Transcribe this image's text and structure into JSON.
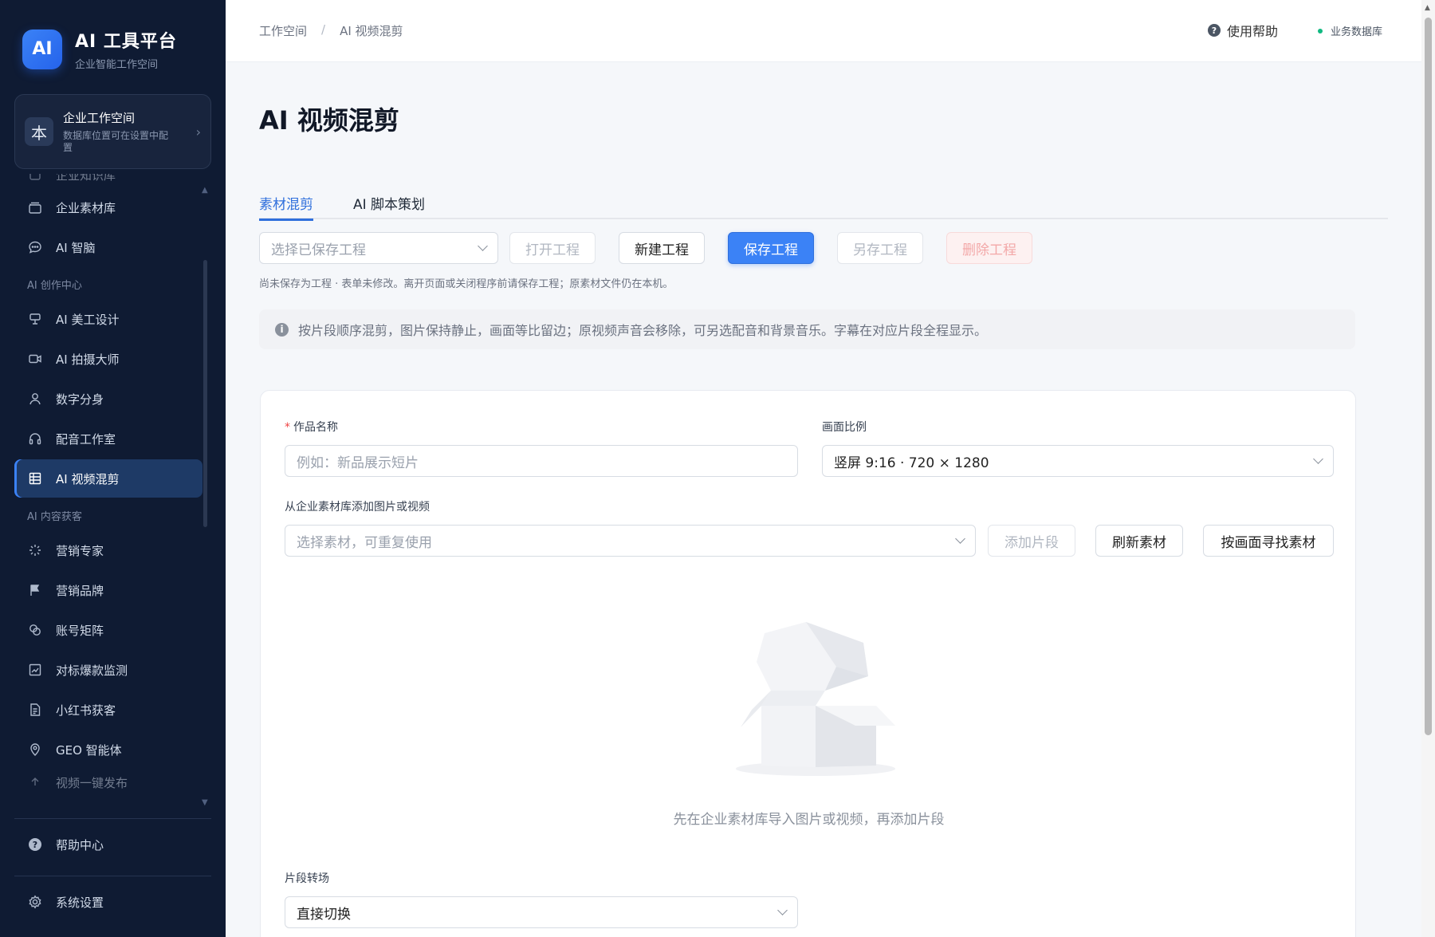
{
  "brand": {
    "logo": "AI",
    "title": "AI 工具平台",
    "subtitle": "企业智能工作空间"
  },
  "workspace": {
    "avatar": "本",
    "title": "企业工作空间",
    "subtitle": "数据库位置可在设置中配置"
  },
  "nav": {
    "partial_top": "企业知识库",
    "items_top": [
      {
        "label": "企业素材库",
        "icon": "archive-icon"
      },
      {
        "label": "AI 智脑",
        "icon": "chat-bubble-icon"
      }
    ],
    "group_create": "AI 创作中心",
    "items_create": [
      {
        "label": "AI 美工设计",
        "icon": "palette-icon"
      },
      {
        "label": "AI 拍摄大师",
        "icon": "video-camera-icon"
      },
      {
        "label": "数字分身",
        "icon": "user-icon"
      },
      {
        "label": "配音工作室",
        "icon": "headphones-icon"
      },
      {
        "label": "AI 视频混剪",
        "icon": "grid-icon",
        "active": true
      }
    ],
    "group_content": "AI 内容获客",
    "items_content": [
      {
        "label": "营销专家",
        "icon": "sparkle-icon"
      },
      {
        "label": "营销品牌",
        "icon": "flag-icon"
      },
      {
        "label": "账号矩阵",
        "icon": "link-icon"
      },
      {
        "label": "对标爆款监测",
        "icon": "chart-icon"
      },
      {
        "label": "小红书获客",
        "icon": "document-icon"
      },
      {
        "label": "GEO 智能体",
        "icon": "location-pin-icon"
      }
    ],
    "partial_bottom": "视频一键发布",
    "help": "帮助中心",
    "settings": "系统设置"
  },
  "topbar": {
    "breadcrumb": [
      "工作空间",
      "AI 视频混剪"
    ],
    "breadcrumb_sep": "/",
    "help": "使用帮助",
    "database": "业务数据库",
    "database_status_color": "#10b981"
  },
  "page": {
    "title": "AI 视频混剪",
    "tabs": [
      {
        "label": "素材混剪",
        "active": true
      },
      {
        "label": "AI 脚本策划"
      }
    ],
    "toolbar": {
      "project_select_placeholder": "选择已保存工程",
      "open": "打开工程",
      "new": "新建工程",
      "save": "保存工程",
      "save_as": "另存工程",
      "delete": "删除工程"
    },
    "notice": "尚未保存为工程 · 表单未修改。离开页面或关闭程序前请保存工程；原素材文件仍在本机。",
    "alert": "按片段顺序混剪，图片保持静止，画面等比留边；原视频声音会移除，可另选配音和背景音乐。字幕在对应片段全程显示。",
    "form": {
      "name_label": "作品名称",
      "name_required_mark": "*",
      "name_placeholder": "例如：新品展示短片",
      "ratio_label": "画面比例",
      "ratio_value": "竖屏 9:16 · 720 × 1280",
      "material_label": "从企业素材库添加图片或视频",
      "material_placeholder": "选择素材，可重复使用",
      "add_segment": "添加片段",
      "refresh": "刷新素材",
      "find_by_image": "按画面寻找素材",
      "empty_text": "先在企业素材库导入图片或视频，再添加片段",
      "transition_label": "片段转场",
      "transition_value": "直接切换"
    }
  },
  "colors": {
    "sidebar_bg": "#0f1b33",
    "accent": "#3b82f6",
    "active_nav": "#1e3a66"
  }
}
